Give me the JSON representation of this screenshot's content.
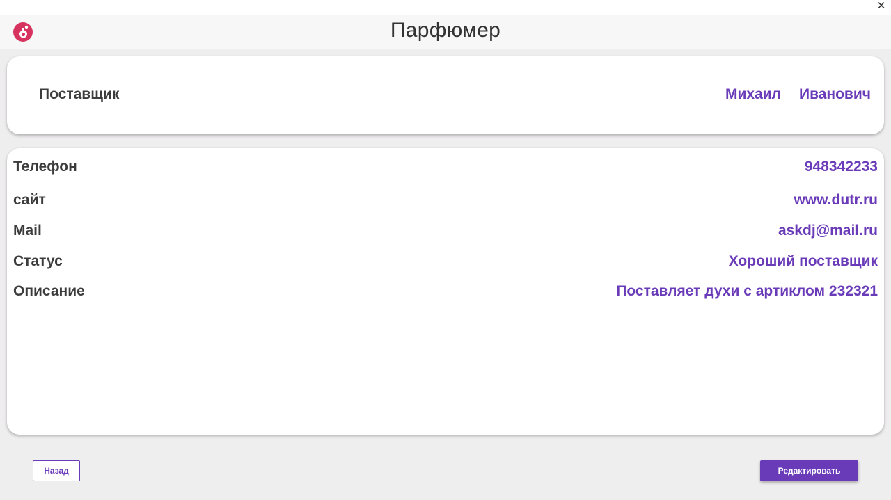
{
  "window": {
    "close_label": "✕"
  },
  "header": {
    "title": "Парфюмер",
    "logo_icon": "perfume-bottle-icon"
  },
  "supplier": {
    "label": "Поставщик",
    "first_name": "Михаил",
    "patronymic": "Иванович"
  },
  "details": {
    "phone_label": "Телефон",
    "phone_value": "948342233",
    "site_label": "сайт",
    "site_value": "www.dutr.ru",
    "mail_label": "Mail",
    "mail_value": "askdj@mail.ru",
    "status_label": "Статус",
    "status_value": "Хороший поставщик",
    "description_label": "Описание",
    "description_value": "Поставляет духи с артиклом 232321"
  },
  "actions": {
    "back_label": "Назад",
    "edit_label": "Редактировать"
  },
  "colors": {
    "accent": "#6a3bb8",
    "logo": "#d7335f",
    "background": "#efeeef"
  }
}
